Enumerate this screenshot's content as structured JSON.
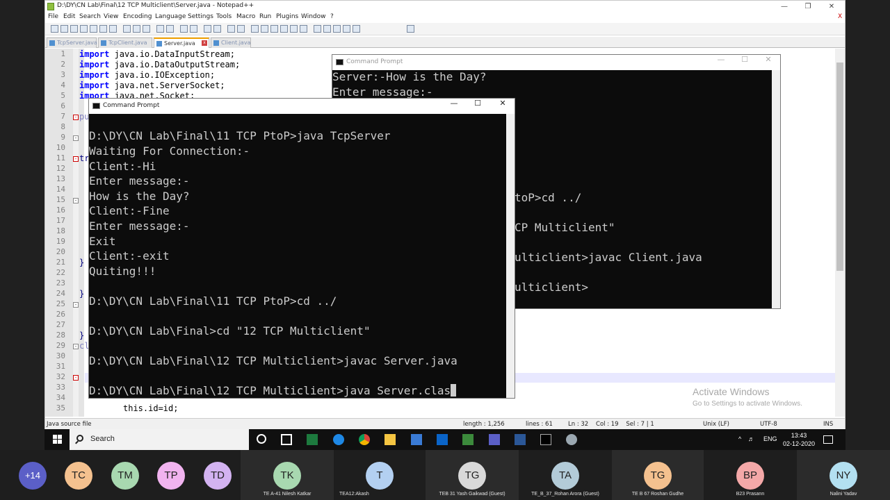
{
  "notepad": {
    "title": "D:\\DY\\CN Lab\\Final\\12 TCP Multiclient\\Server.java - Notepad++",
    "menu": [
      "File",
      "Edit",
      "Search",
      "View",
      "Encoding",
      "Language",
      "Settings",
      "Tools",
      "Macro",
      "Run",
      "Plugins",
      "Window",
      "?"
    ],
    "menu_close": "X",
    "tabs": [
      "TcpServer.java",
      "TcpClient.java",
      "Server.java",
      "Client.java"
    ],
    "active_tab": "Server.java",
    "line_numbers": [
      "1",
      "2",
      "3",
      "4",
      "5",
      "6",
      "7",
      "8",
      "9",
      "10",
      "11",
      "12",
      "13",
      "14",
      "15",
      "16",
      "17",
      "18",
      "19",
      "20",
      "21",
      "22",
      "23",
      "24",
      "25",
      "26",
      "27",
      "28",
      "29",
      "30",
      "31",
      "32",
      "33",
      "34",
      "35"
    ],
    "code": {
      "l1_kw": "import",
      "l1_rest": " java.io.DataInputStream;",
      "l2_kw": "import",
      "l2_rest": " java.io.DataOutputStream;",
      "l3_kw": "import",
      "l3_rest": " java.io.IOException;",
      "l4_kw": "import",
      "l4_rest": " java.net.ServerSocket;",
      "l5_kw": "import",
      "l5_rest": " java.net.Socket;",
      "l7": "pu",
      "l11": "tr",
      "l21": "}",
      "l24": "}",
      "l28": "}",
      "l29": "cl",
      "l35": "this.id=id;"
    },
    "status": {
      "type": "Java source file",
      "length": "length : 1,256",
      "lines": "lines : 61",
      "position": "Ln : 32    Col : 19    Sel : 7 | 1",
      "eol": "Unix (LF)",
      "encoding": "UTF-8",
      "mode": "INS"
    }
  },
  "cmd_back": {
    "title": "Command Prompt",
    "lines": [
      "Server:-How is the Day?",
      "Enter message:-"
    ],
    "partial_lines": [
      "toP>cd ../",
      "CP Multiclient\"",
      "ulticlient>javac Client.java",
      "ulticlient>"
    ]
  },
  "cmd_front": {
    "title": "Command Prompt",
    "lines": [
      "D:\\DY\\CN Lab\\Final\\11 TCP PtoP>java TcpServer",
      "Waiting For Connection:-",
      "Client:-Hi",
      "Enter message:-",
      "How is the Day?",
      "Client:-Fine",
      "Enter message:-",
      "Exit",
      "Client:-exit",
      "Quiting!!!",
      "",
      "D:\\DY\\CN Lab\\Final\\11 TCP PtoP>cd ../",
      "",
      "D:\\DY\\CN Lab\\Final>cd \"12 TCP Multiclient\"",
      "",
      "D:\\DY\\CN Lab\\Final\\12 TCP Multiclient>javac Server.java",
      "",
      "D:\\DY\\CN Lab\\Final\\12 TCP Multiclient>java Server.clas"
    ]
  },
  "watermark": {
    "title": "Activate Windows",
    "subtitle": "Go to Settings to activate Windows."
  },
  "taskbar": {
    "search_label": "Search",
    "language": "ENG",
    "time": "13:43",
    "date": "02-12-2020"
  },
  "participants": [
    {
      "initials": "+14",
      "name": "",
      "color": "#5b5fc7"
    },
    {
      "initials": "TC",
      "name": "",
      "color": "#f4c18f"
    },
    {
      "initials": "TM",
      "name": "",
      "color": "#a8d8b0"
    },
    {
      "initials": "TP",
      "name": "",
      "color": "#f1b3ef"
    },
    {
      "initials": "TD",
      "name": "",
      "color": "#d3b3f1"
    },
    {
      "initials": "TK",
      "name": "TE A-41 Nilesh Katkar",
      "color": "#a8d8b0"
    },
    {
      "initials": "T",
      "name": "TEA12:Akash",
      "color": "#b3d0f1"
    },
    {
      "initials": "TG",
      "name": "TEB 31 Yash Gaikwad (Guest)",
      "color": "#d9d9d9"
    },
    {
      "initials": "TA",
      "name": "TE_B_37_Rohan Arora (Guest)",
      "color": "#b3cbd8"
    },
    {
      "initials": "TG",
      "name": "TE B 67 Roshan Gudhe",
      "color": "#f4c18f"
    },
    {
      "initials": "BP",
      "name": "B23 Prasann",
      "color": "#f4a8a8"
    },
    {
      "initials": "NY",
      "name": "Nalini Yadav",
      "color": "#b3e0f1"
    }
  ]
}
